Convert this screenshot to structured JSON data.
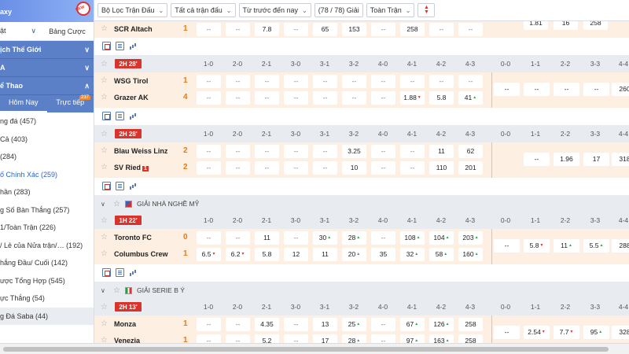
{
  "sidebar": {
    "top_label": "axy",
    "tabs": {
      "left": "ật",
      "right": "Bảng Cược"
    },
    "sec1": "ịch Thế Giới",
    "sec2": "A",
    "sec3": "ể Thao",
    "subtabs": {
      "today": "Hôm Nay",
      "live": "Trực tiếp",
      "live_count": "237"
    },
    "items": [
      "ng đá (457)",
      "Cả (403)",
      "(284)",
      "ố Chính Xác (259)",
      "hần (283)",
      "g Số Bàn Thắng (257)",
      "1/Toàn Trận (226)",
      "/ Lẻ của Nửa trận/…   (192)",
      "hắng Đầu/ Cuối (142)",
      "ược Tổng Hợp (545)",
      "ực Thắng (54)",
      "g Đá Saba (44)"
    ]
  },
  "filters": {
    "bo_loc": "Bộ Lọc Trận Đấu",
    "tat_ca": "Tất cả trận đấu",
    "tu_truoc": "Từ trước đến nay",
    "count": "(78 / 78) Giải",
    "toan_tran": "Toàn Trận"
  },
  "score_labels_a": [
    "1-0",
    "2-0",
    "2-1",
    "3-0",
    "3-1",
    "3-2",
    "4-0",
    "4-1",
    "4-2",
    "4-3"
  ],
  "score_labels_b": [
    "0-0",
    "1-1",
    "2-2",
    "3-3",
    "4-4"
  ],
  "top_partial": {
    "team": "SCR Altach",
    "score": "1",
    "cells": [
      "--",
      "--",
      "7.8",
      "--",
      "65",
      "153",
      "--",
      "258",
      "--",
      "--"
    ],
    "right": [
      "1.81",
      "16",
      "258"
    ]
  },
  "matches": [
    {
      "time": "2H 28'",
      "home": {
        "name": "WSG Tirol",
        "score": "1",
        "cells": [
          "--",
          "--",
          "--",
          "--",
          "--",
          "--",
          "--",
          "--",
          "--",
          "--"
        ],
        "right": [
          "--",
          "--",
          "--",
          "--",
          "260"
        ]
      },
      "away": {
        "name": "Grazer AK",
        "score": "4",
        "cells": [
          "--",
          "--",
          "--",
          "--",
          "--",
          "--",
          "--",
          "1.88",
          "5.8",
          "41"
        ],
        "right": []
      }
    },
    {
      "time": "2H 28'",
      "home": {
        "name": "Blau Weiss Linz",
        "score": "2",
        "cells": [
          "--",
          "--",
          "--",
          "--",
          "--",
          "3.25",
          "--",
          "--",
          "11",
          "62"
        ],
        "right": [
          "--",
          "1.96",
          "17",
          "318"
        ]
      },
      "away": {
        "name": "SV Ried",
        "score": "2",
        "redcard": "1",
        "cells": [
          "--",
          "--",
          "--",
          "--",
          "--",
          "10",
          "--",
          "--",
          "110",
          "201"
        ],
        "right": []
      }
    },
    {
      "league": "GIẢI NHÀ NGHỀ MỸ",
      "time": "1H 22'",
      "home": {
        "name": "Toronto FC",
        "score": "0",
        "cells": [
          "--",
          "--",
          "11",
          "--",
          "30",
          "28",
          "--",
          "108",
          "104",
          "203"
        ],
        "right": [
          "--",
          "5.8",
          "11",
          "5.5",
          "288"
        ]
      },
      "away": {
        "name": "Columbus Crew",
        "score": "1",
        "cells": [
          "6.5",
          "6.2",
          "5.8",
          "12",
          "11",
          "20",
          "35",
          "32",
          "58",
          "160"
        ],
        "right": []
      }
    },
    {
      "league": "GIẢI SERIE B Ý",
      "time": "2H 13'",
      "home": {
        "name": "Monza",
        "score": "1",
        "cells": [
          "--",
          "--",
          "4.35",
          "--",
          "13",
          "25",
          "--",
          "67",
          "126",
          "258"
        ],
        "right": [
          "--",
          "2.54",
          "7.7",
          "95",
          "328"
        ]
      },
      "away": {
        "name": "Venezia",
        "score": "1",
        "cells": [
          "--",
          "--",
          "5.2",
          "--",
          "17",
          "28",
          "--",
          "97",
          "163",
          "258"
        ],
        "right": []
      }
    }
  ],
  "colors": {
    "accent": "#5b80c8",
    "live_red": "#d9342b",
    "score_orange": "#e57a1a",
    "row_bg": "#fdf0e3"
  }
}
